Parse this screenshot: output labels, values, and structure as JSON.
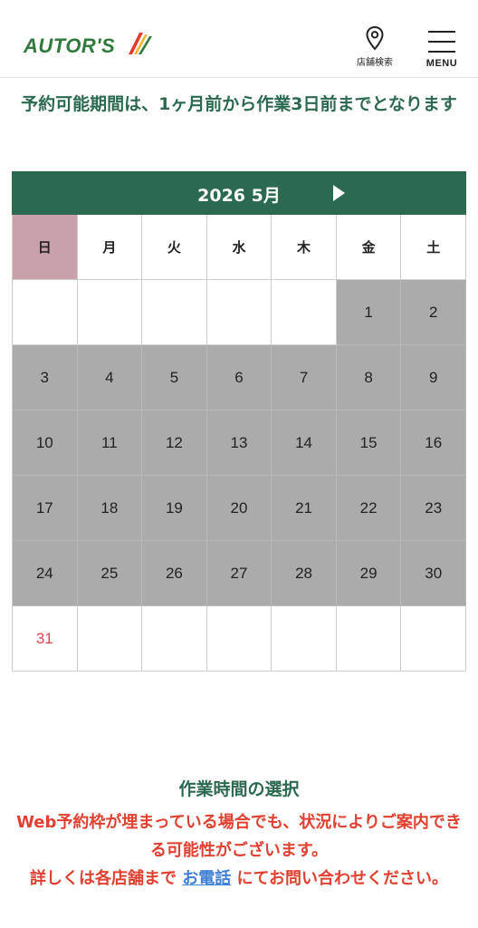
{
  "header": {
    "logo_text": "AUTOR'S",
    "store_search_label": "店舗検索",
    "menu_label": "MENU"
  },
  "notice": {
    "text": "予約可能期間は、1ヶ月前から作業3日前までとなります"
  },
  "calendar": {
    "month_label": "2026 5月",
    "weekdays": [
      "日",
      "月",
      "火",
      "水",
      "木",
      "金",
      "土"
    ],
    "days": [
      "",
      "",
      "",
      "",
      "",
      "1",
      "2",
      "3",
      "4",
      "5",
      "6",
      "7",
      "8",
      "9",
      "10",
      "11",
      "12",
      "13",
      "14",
      "15",
      "16",
      "17",
      "18",
      "19",
      "20",
      "21",
      "22",
      "23",
      "24",
      "25",
      "26",
      "27",
      "28",
      "29",
      "30",
      "31",
      "",
      "",
      "",
      "",
      "",
      ""
    ]
  },
  "section": {
    "title": "作業時間の選択",
    "warning_part1": "Web予約枠が埋まっている場合でも、状況によりご案内できる可能性がございます。",
    "warning_part2": "詳しくは各店舗まで",
    "phone_link": "お電話",
    "warning_part3": "にてお問い合わせください。"
  },
  "colors": {
    "brand_green": "#2c6a4f",
    "unavailable_gray": "#ababab",
    "sunday_header": "#c9a1aa",
    "warning_red": "#e0402f",
    "link_blue": "#3f7fd6"
  }
}
